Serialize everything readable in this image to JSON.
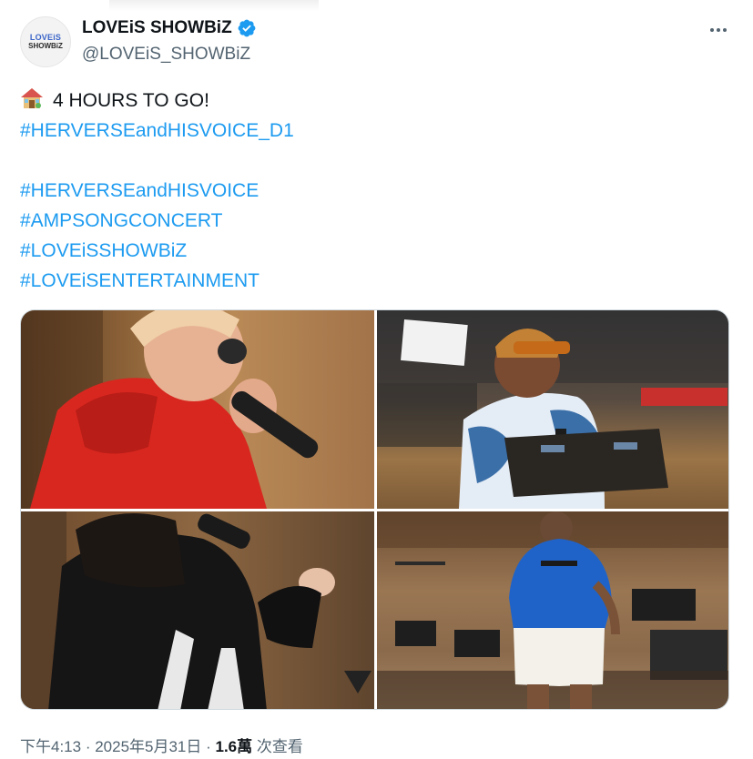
{
  "author": {
    "display_name": "LOVEiS SHOWBiZ",
    "handle": "@LOVEiS_SHOWBiZ",
    "avatar_line1": "LOVEiS",
    "avatar_line2": "SHOWBiZ",
    "verified_icon": "verified-badge-icon",
    "verified_color": "#1d9bf0"
  },
  "more_icon": "more-horizontal-icon",
  "tweet": {
    "emoji_icon": "house-emoji-icon",
    "line1": "4 HOURS TO GO!",
    "hashtags_top": [
      "#HERVERSEandHISVOICE_D1"
    ],
    "hashtags": [
      "#HERVERSEandHISVOICE",
      "#AMPSONGCONCERT",
      "#LOVEiSSHOWBiZ",
      "#LOVEiSENTERTAINMENT"
    ]
  },
  "media": {
    "photos": [
      {
        "name": "singer-red-hoodie-photo"
      },
      {
        "name": "singer-orange-beanie-photo"
      },
      {
        "name": "singer-black-hoodie-photo"
      },
      {
        "name": "singer-blue-shirt-photo"
      }
    ]
  },
  "meta": {
    "time": "下午4:13",
    "sep1": " · ",
    "date": "2025年5月31日",
    "sep2": " · ",
    "views_count": "1.6萬",
    "views_label": " 次查看"
  },
  "colors": {
    "link": "#1d9bf0",
    "text": "#0f1419",
    "secondary": "#536471",
    "border": "#cfd9de"
  }
}
